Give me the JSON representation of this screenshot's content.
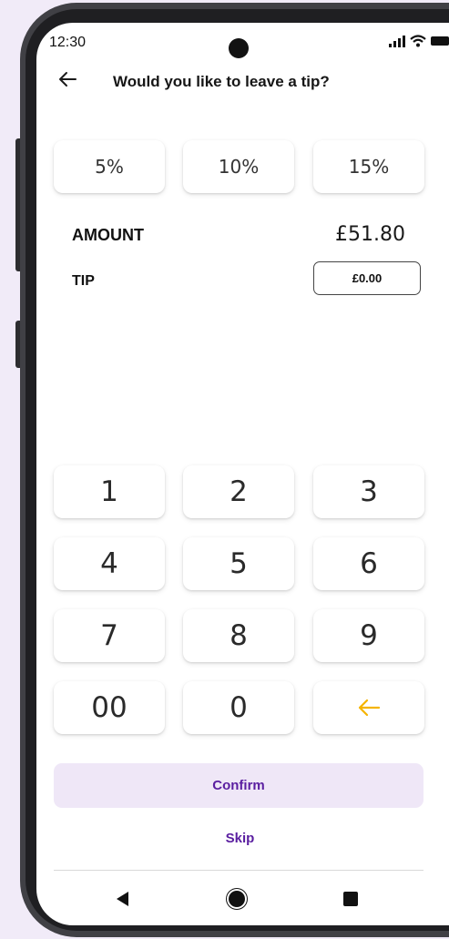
{
  "status_bar": {
    "time": "12:30",
    "icons": [
      "signal-icon",
      "wifi-icon",
      "battery-icon"
    ]
  },
  "header": {
    "back_icon": "arrow-left-icon",
    "title": "Would you like to leave a tip?"
  },
  "tip_options": [
    {
      "label": "5%"
    },
    {
      "label": "10%"
    },
    {
      "label": "15%"
    }
  ],
  "summary": {
    "amount_label": "AMOUNT",
    "amount_value": "£51.80",
    "tip_label": "TIP",
    "tip_value": "£0.00"
  },
  "keypad": {
    "keys": [
      "1",
      "2",
      "3",
      "4",
      "5",
      "6",
      "7",
      "8",
      "9",
      "00",
      "0"
    ],
    "backspace_icon": "backspace-arrow-icon",
    "backspace_color": "#f5b400"
  },
  "actions": {
    "confirm_label": "Confirm",
    "skip_label": "Skip"
  },
  "navigation": [
    "nav-back-icon",
    "nav-home-icon",
    "nav-recents-icon"
  ],
  "colors": {
    "accent": "#5a1ea0",
    "confirm_bg": "#efe7f7",
    "page_bg": "#f1ebf8"
  }
}
